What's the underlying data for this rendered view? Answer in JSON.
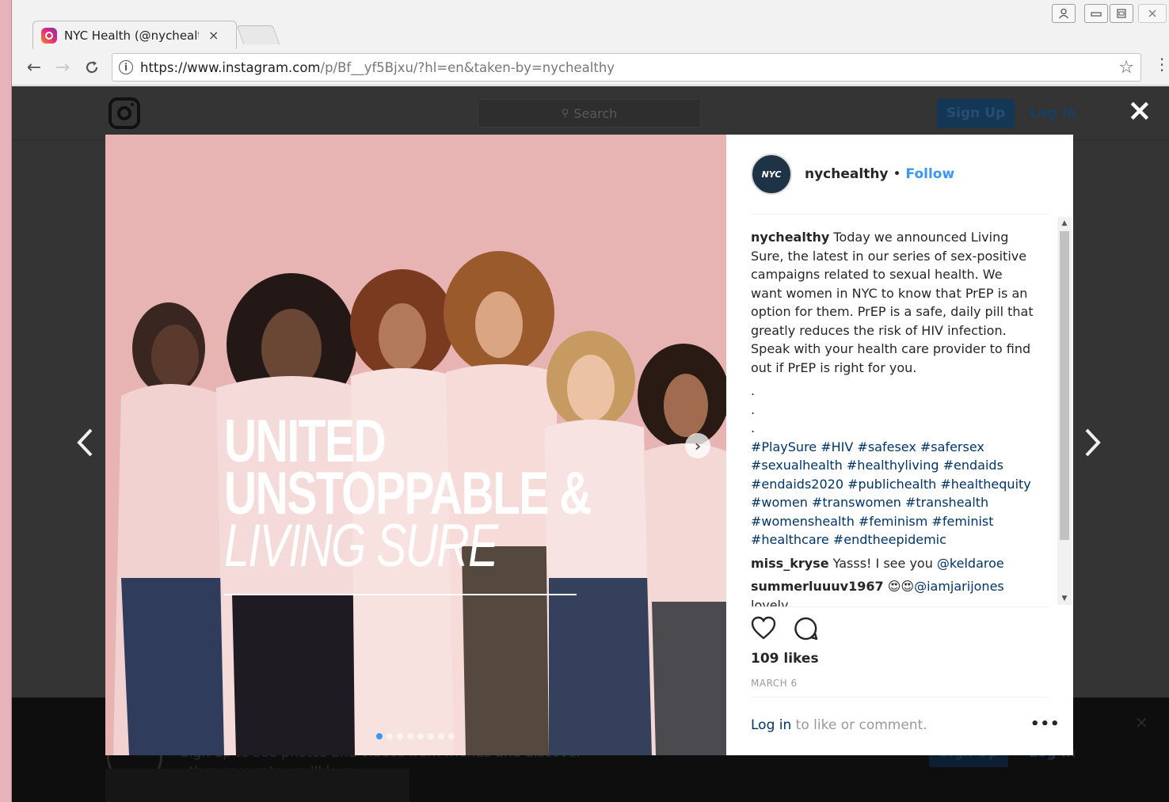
{
  "browser": {
    "tab_title": "NYC Health (@nychealth",
    "tab_close": "×",
    "url_host": "https://www.instagram.com",
    "url_path": "/p/Bf__yf5Bjxu/?hl=en&taken-by=nychealthy",
    "back_icon": "←",
    "forward_icon": "→",
    "reload_icon": "C",
    "star_icon": "☆"
  },
  "instagram_header": {
    "search_placeholder": "Search",
    "sign_up": "Sign Up",
    "log_in": "Log In",
    "close": "×"
  },
  "post": {
    "overlay_lines": [
      "UNITED",
      "UNSTOPPABLE &",
      "LIVING SURE"
    ],
    "carousel_dots": 8,
    "active_dot": 0,
    "author": "nychealthy",
    "follow": "Follow",
    "avatar_text": "NYC",
    "caption": "Today we announced Living Sure, the latest in our series of sex-positive campaigns related to sexual health. We want women in NYC to know that PrEP is an option for them. PrEP is a safe, daily pill that greatly reduces the risk of HIV infection. Speak with your health care provider to find out if PrEP is right for you.",
    "caption_dots": [
      ".",
      ".",
      "."
    ],
    "hashtags": "#PlaySure #HIV #safesex #safersex #sexualhealth #healthyliving #endaids #endaids2020 #publichealth #healthequity #women #transwomen #transhealth #womenshealth #feminism #feminist #healthcare #endtheepidemic",
    "comments": [
      {
        "user": "miss_kryse",
        "text": "Yasss! I see you ",
        "mention": "@keldaroe"
      },
      {
        "user": "summerluuuv1967",
        "text": "😍😍",
        "mention": "@iamjarijones"
      },
      {
        "user": "",
        "text": "lovely",
        "mention": ""
      }
    ],
    "likes": "109 likes",
    "date": "MARCH 6",
    "login_link": "Log in",
    "login_rest": " to like or comment.",
    "more": "•••"
  },
  "bottom_banner": {
    "text": "Sign up to see photos and videos from friends and discover other accounts you'll love.",
    "sign_up": "Sign Up",
    "log_in": "Log In"
  },
  "colors": {
    "accent": "#3897f0",
    "photo_bg": "#e9b8b6",
    "link": "#003569"
  }
}
